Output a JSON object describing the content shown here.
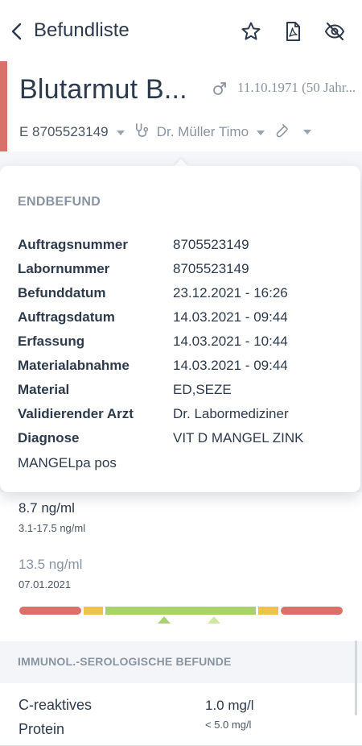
{
  "topbar": {
    "back_label": "Befundliste",
    "icons": [
      "star-icon",
      "pdf-icon",
      "eye-off-icon"
    ]
  },
  "header": {
    "title": "Blutarmut B...",
    "birthdate": "11.10.1971 (50 Jahr...",
    "order_id": "E 8705523149",
    "doctor": "Dr. Müller Timo",
    "accent_color": "#d9706a"
  },
  "popup": {
    "heading": "ENDBEFUND",
    "rows": [
      {
        "label": "Auftragsnummer",
        "value": "8705523149"
      },
      {
        "label": "Labornummer",
        "value": "8705523149"
      },
      {
        "label": "Befunddatum",
        "value": "23.12.2021 - 16:26"
      },
      {
        "label": "Auftragsdatum",
        "value": "14.03.2021 - 09:44"
      },
      {
        "label": "Erfassung",
        "value": "14.03.2021 - 10:44"
      },
      {
        "label": "Materialabnahme",
        "value": "14.03.2021 - 09:44"
      },
      {
        "label": "Material",
        "value": "ED,SEZE"
      },
      {
        "label": "Validierender Arzt",
        "value": "Dr. Labormediziner"
      },
      {
        "label": "Diagnose",
        "value": "VIT D MANGEL ZINK"
      }
    ],
    "diagnosis_continued": "MANGELpa pos"
  },
  "result": {
    "current_value": "8.7 ng/ml",
    "reference_range": "3.1-17.5 ng/ml",
    "previous_value": "13.5 ng/ml",
    "previous_date": "07.01.2021",
    "colors": {
      "red": "#d9706a",
      "yellow": "#edc24f",
      "green": "#a9d36a",
      "light_green": "#cfe6a6"
    }
  },
  "section": {
    "title": "IMMUNOL.-SEROLOGISCHE BEFUNDE"
  },
  "crp": {
    "name": "C-reaktives Protein",
    "value": "1.0 mg/l",
    "range": "< 5.0 mg/l"
  }
}
